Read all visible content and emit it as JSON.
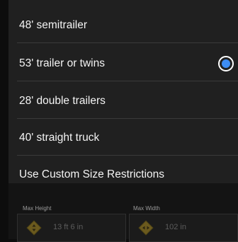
{
  "options": [
    {
      "label": "48' semitrailer",
      "selected": false
    },
    {
      "label": "53' trailer or twins",
      "selected": true
    },
    {
      "label": "28' double trailers",
      "selected": false
    },
    {
      "label": "40' straight truck",
      "selected": false
    }
  ],
  "custom": {
    "label": "Use Custom Size Restrictions",
    "max_height_label": "Max Height",
    "max_height_value": "13 ft 6 in",
    "max_width_label": "Max Width",
    "max_width_value": "102 in"
  },
  "colors": {
    "accent": "#3d8df5",
    "warning_sign": "#6b5a1e"
  }
}
